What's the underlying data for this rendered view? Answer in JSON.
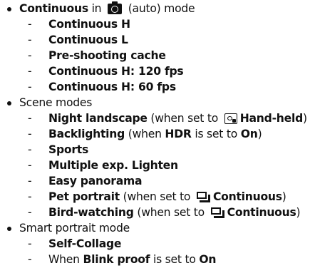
{
  "items": [
    {
      "lead": "Continuous",
      "mid": " in ",
      "tail": " (auto) mode"
    },
    {
      "label": "Continuous H"
    },
    {
      "label": "Continuous L"
    },
    {
      "label": "Pre-shooting cache"
    },
    {
      "label": "Continuous H: 120 fps"
    },
    {
      "label": "Continuous H: 60 fps"
    },
    {
      "label": "Scene modes"
    },
    {
      "lead": "Night landscape",
      "mid": " (when set to ",
      "strong": "Hand-held",
      "tail": ")"
    },
    {
      "lead": "Backlighting",
      "mid": " (when ",
      "strong": "HDR",
      "mid2": " is set to ",
      "strong2": "On",
      "tail": ")"
    },
    {
      "label": "Sports"
    },
    {
      "label": "Multiple exp. Lighten"
    },
    {
      "label": "Easy panorama"
    },
    {
      "lead": "Pet portrait",
      "mid": " (when set to ",
      "strong": "Continuous",
      "tail": ")"
    },
    {
      "lead": "Bird-watching",
      "mid": " (when set to ",
      "strong": "Continuous",
      "tail": ")"
    },
    {
      "label": "Smart portrait mode"
    },
    {
      "label": "Self-Collage"
    },
    {
      "lead": "When ",
      "strong": "Blink proof",
      "mid": " is set to ",
      "strong2": "On"
    }
  ],
  "dash": "-",
  "icons": [
    "camera-auto-icon",
    "hand-held-icon",
    "continuous-icon"
  ]
}
